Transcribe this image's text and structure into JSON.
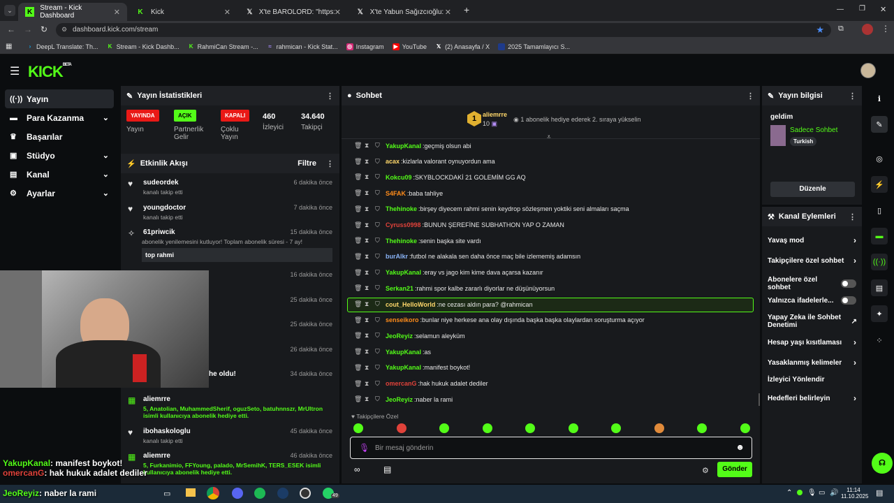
{
  "browser": {
    "tabs": [
      {
        "title": "Stream - Kick Dashboard",
        "icon": "kick-icon",
        "active": true
      },
      {
        "title": "Kick",
        "icon": "kick-icon",
        "active": false
      },
      {
        "title": "X'te BAROLORD: \"https://t.co/w",
        "icon": "x-icon",
        "active": false
      },
      {
        "title": "X'te Yabun Sağızcıoğlu: \" KN",
        "icon": "x-icon",
        "active": false
      }
    ],
    "url": "dashboard.kick.com/stream",
    "bookmarks": [
      "DeepL Translate: Th...",
      "Stream - Kick Dashb...",
      "RahmiCan Stream -...",
      "rahmican - Kick Stat...",
      "Instagram",
      "YouTube",
      "(2) Anasayfa / X",
      "2025 Tamamlayıcı S..."
    ]
  },
  "header": {
    "logo": "KICK",
    "beta": "BETA"
  },
  "sidebar": {
    "items": [
      {
        "label": "Yayın",
        "icon": "broadcast-icon",
        "chevron": false,
        "active": true
      },
      {
        "label": "Para Kazanma",
        "icon": "money-icon",
        "chevron": true
      },
      {
        "label": "Başarılar",
        "icon": "trophy-icon",
        "chevron": false
      },
      {
        "label": "Stüdyo",
        "icon": "studio-icon",
        "chevron": true
      },
      {
        "label": "Kanal",
        "icon": "channel-icon",
        "chevron": true
      },
      {
        "label": "Ayarlar",
        "icon": "gear-icon",
        "chevron": true
      }
    ]
  },
  "stats": {
    "title": "Yayın İstatistikleri",
    "items": [
      {
        "badge": "YAYINDA",
        "label": "Yayın",
        "color": "#e91916"
      },
      {
        "badge": "AÇIK",
        "label": "Partnerlik Gelir",
        "color": "#53fc18"
      },
      {
        "badge": "KAPALI",
        "label": "Çoklu Yayın",
        "color": "#e91916"
      },
      {
        "value": "460",
        "label": "İzleyici"
      },
      {
        "value": "34.640",
        "label": "Takipçi"
      }
    ]
  },
  "activity": {
    "title": "Etkinlik Akışı",
    "filter": "Filtre",
    "events": [
      {
        "name": "sudeordek",
        "sub": "kanalı takip etti",
        "time": "6 dakika önce"
      },
      {
        "name": "youngdoctor",
        "sub": "kanalı takip etti",
        "time": "7 dakika önce"
      },
      {
        "name": "61priwcik",
        "sub": "abonelik yenilemesini kutluyor! Toplam abonelik süresi - 7 ay!",
        "time": "15 dakika önce",
        "msg": "top rahmi"
      },
      {
        "time": "16 dakika önce"
      },
      {
        "time": "25 dakika önce"
      },
      {
        "time": "25 dakika önce"
      },
      {
        "time": "26 dakika önce"
      },
      {
        "frag": "he oldu!",
        "time": "34 dakika önce"
      },
      {
        "name": "aliemrre",
        "sub": "5, Anatolian, MuhammedSherif, oguzSeto, batuhnnszr, MrUltron isimli kullanıcıya abonelik hediye etti.",
        "time": ""
      },
      {
        "name": "ibohaskologlu",
        "sub": "kanalı takip etti",
        "time": "45 dakika önce"
      },
      {
        "name": "aliemrre",
        "sub": "5, Furkanimio, FFYoung, palado, MrSemihK, TERS_ESEK isimli kullanıcıya abonelik hediye etti.",
        "time": "46 dakika önce"
      }
    ]
  },
  "chat": {
    "title": "Sohbet",
    "pinned_user": "aliemrre",
    "pinned_count": "10",
    "pinned_rank": "1",
    "pinned_note": "1 abonelik hediye ederek 2. sıraya yükselin",
    "messages": [
      {
        "user": "YakupKanal",
        "text": "geçmiş olsun abi",
        "color": "#53fc18"
      },
      {
        "user": "acax",
        "text": "kizlarla valorant oynuyordun ama",
        "color": "#ffd86b"
      },
      {
        "user": "Kokcu09",
        "text": "SKYBLOCKDAKİ 21 GOLEMİM GG AQ",
        "color": "#53fc18"
      },
      {
        "user": "S4FAK",
        "text": "baba tahliye",
        "color": "#ff8c1a"
      },
      {
        "user": "Thehinoke",
        "text": "birşey diyecem rahmi senin keydrop sözleşmen yoktiki seni almaları saçma",
        "color": "#53fc18"
      },
      {
        "user": "Cyruss0998",
        "text": "BUNUN ŞEREFİNE SUBHATHON YAP O ZAMAN",
        "color": "#e0423a"
      },
      {
        "user": "Thehinoke",
        "text": "senin başka site vardı",
        "color": "#53fc18"
      },
      {
        "user": "burAlkr",
        "text": "futbol ne alakala sen daha önce maç bile izlememiş adamsın",
        "color": "#8ab4f8"
      },
      {
        "user": "YakupKanal",
        "text": "eray vs jago kim kime dava açarsa kazanır",
        "color": "#53fc18"
      },
      {
        "user": "Serkan21",
        "text": "rahmi spor kalbe zararlı diyorlar ne düşünüyorsun",
        "color": "#53fc18"
      },
      {
        "user": "cout_HelloWorld",
        "text": "ne cezası aldın para? @rahmican",
        "color": "#ffd86b",
        "highlight": true
      },
      {
        "user": "senseikoro",
        "text": "bunlar niye herkese ana olay dışında başka başka olaylardan soruşturma açıyor",
        "color": "#ff8c1a"
      },
      {
        "user": "JeoReyiz",
        "text": "selamun aleyküm",
        "color": "#53fc18"
      },
      {
        "user": "YakupKanal",
        "text": "as",
        "color": "#53fc18"
      },
      {
        "user": "YakupKanal",
        "text": "manifest boykot!",
        "color": "#53fc18"
      },
      {
        "user": "omercanG",
        "text": "hak hukuk adalet dediler",
        "color": "#e0423a"
      },
      {
        "user": "JeoReyiz",
        "text": "naber la rami",
        "color": "#53fc18"
      }
    ],
    "emote_label": "Takipçilere Özel",
    "input_placeholder": "Bir mesaj gönderin",
    "send_label": "Gönder"
  },
  "info": {
    "title": "Yayın bilgisi",
    "stream_title": "geldim",
    "category": "Sadece Sohbet",
    "language": "Turkish",
    "edit_label": "Düzenle"
  },
  "channel_actions": {
    "title": "Kanal Eylemleri",
    "items": [
      {
        "label": "Yavaş mod",
        "type": "chevron"
      },
      {
        "label": "Takipçilere özel sohbet",
        "type": "chevron"
      },
      {
        "label": "Abonelere özel sohbet",
        "type": "toggle"
      },
      {
        "label": "Yalnızca ifadelerle...",
        "type": "toggle"
      },
      {
        "label": "Yapay Zeka ile Sohbet Denetimi",
        "type": "link"
      },
      {
        "label": "Hesap yaşı kısıtlaması",
        "type": "chevron"
      },
      {
        "label": "Yasaklanmış kelimeler",
        "type": "chevron"
      },
      {
        "label": "İzleyici Yönlendir",
        "type": "none"
      },
      {
        "label": "Hedefleri belirleyin",
        "type": "chevron"
      }
    ]
  },
  "overlay": {
    "lines": [
      {
        "user": "YakupKanal",
        "text": ": manifest boykot!",
        "color": "#53fc18"
      },
      {
        "user": "omercanG",
        "text": ": hak hukuk adalet dediler",
        "color": "#e0423a"
      },
      {
        "user": "JeoReyiz",
        "text": ": naber la rami",
        "color": "#53fc18"
      }
    ]
  },
  "taskbar": {
    "time": "11:14",
    "date": "11.10.2025",
    "badge": "49"
  }
}
